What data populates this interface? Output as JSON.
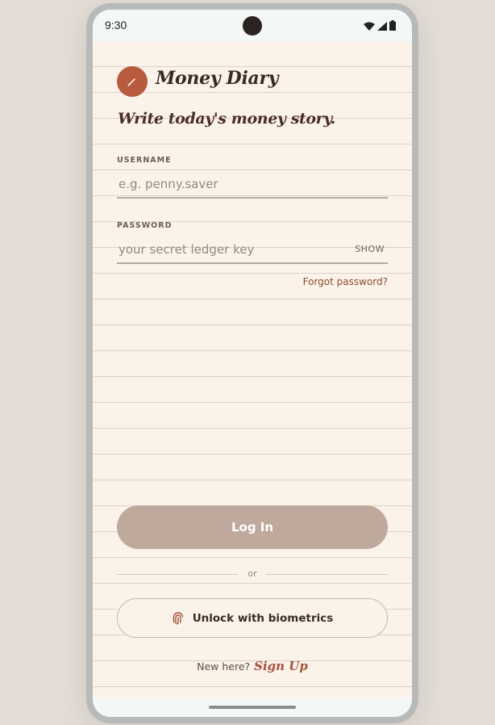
{
  "status_bar": {
    "time": "9:30",
    "icons": [
      "wifi-icon",
      "cellular-icon",
      "battery-icon"
    ]
  },
  "brand": {
    "icon": "pen-icon",
    "title": "Money Diary",
    "tagline": "Write today's money story."
  },
  "form": {
    "username": {
      "label": "USERNAME",
      "placeholder": "e.g. penny.saver",
      "value": ""
    },
    "password": {
      "label": "PASSWORD",
      "placeholder": "your secret ledger key",
      "value": "",
      "toggle_label": "SHOW"
    },
    "forgot_label": "Forgot password?"
  },
  "actions": {
    "login_label": "Log In",
    "divider_label": "or",
    "biometrics_label": "Unlock with biometrics",
    "biometrics_icon": "fingerprint-icon"
  },
  "signup": {
    "prompt": "New here?",
    "link_label": "Sign Up"
  },
  "colors": {
    "background": "#fbf3ea",
    "accent": "#b85a3e",
    "primary_button": "#bfa99d",
    "text": "#3b2a24"
  }
}
